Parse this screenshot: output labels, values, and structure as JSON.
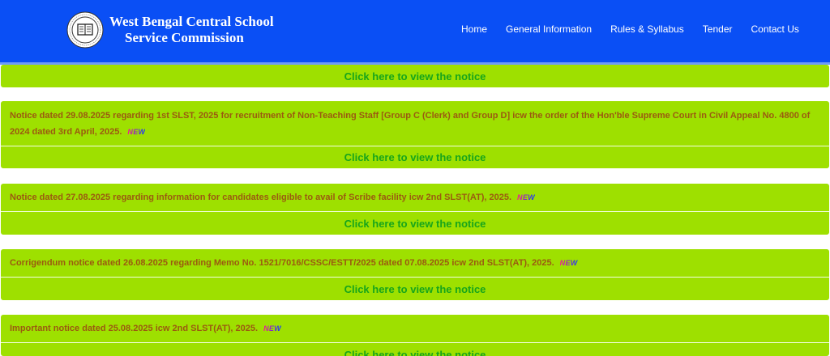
{
  "header": {
    "org_line1": "West Bengal Central School",
    "org_line2": "Service Commission",
    "colors": {
      "bar": "#0a4ff5",
      "card": "#9ee000",
      "notice_text": "#9b5a10",
      "link": "#17a51b"
    }
  },
  "nav": [
    {
      "label": "Home"
    },
    {
      "label": "General Information"
    },
    {
      "label": "Rules & Syllabus"
    },
    {
      "label": "Tender"
    },
    {
      "label": "Contact Us"
    }
  ],
  "notices": [
    {
      "link_label": "Click here to view the notice"
    },
    {
      "text": "Notice dated 29.08.2025 regarding 1st SLST, 2025 for recruitment of Non-Teaching Staff [Group C (Clerk) and Group D] icw the order of the Hon'ble Supreme Court in Civil Appeal No. 4800 of 2024 dated 3rd April, 2025.",
      "badge": "NEW",
      "link_label": "Click here to view the notice"
    },
    {
      "text": "Notice dated 27.08.2025 regarding information for candidates eligible to avail of Scribe facility icw 2nd SLST(AT), 2025.",
      "badge": "NEW",
      "link_label": "Click here to view the notice"
    },
    {
      "text": "Corrigendum notice dated 26.08.2025 regarding Memo No. 1521/7016/CSSC/ESTT/2025 dated 07.08.2025 icw 2nd SLST(AT), 2025.",
      "badge": "NEW",
      "link_label": "Click here to view the notice"
    },
    {
      "text": "Important notice dated 25.08.2025 icw 2nd SLST(AT), 2025.",
      "badge": "NEW",
      "link_label": "Click here to view the notice"
    }
  ]
}
